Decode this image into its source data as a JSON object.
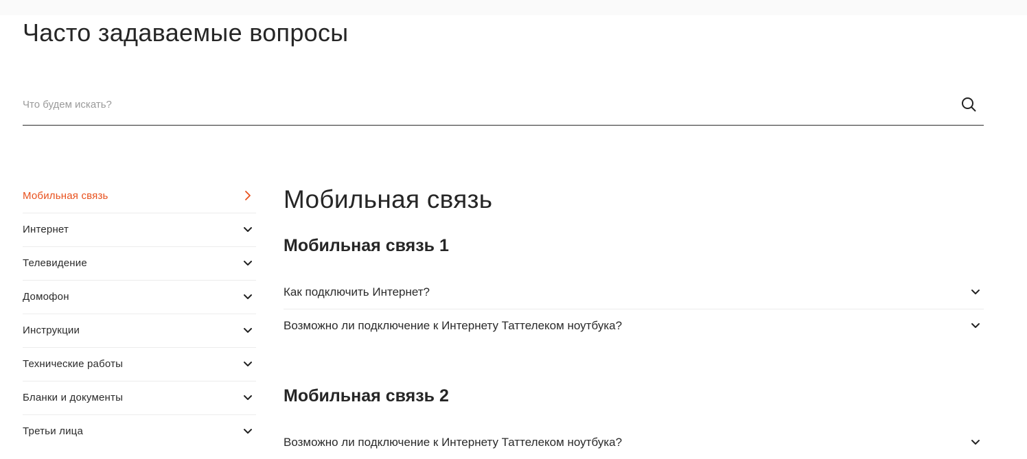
{
  "page": {
    "title": "Часто задаваемые вопросы"
  },
  "search": {
    "placeholder": "Что будем искать?",
    "value": ""
  },
  "sidebar": {
    "items": [
      {
        "label": "Мобильная связь",
        "active": true,
        "icon": "chevron-right-icon"
      },
      {
        "label": "Интернет",
        "icon": "chevron-down-icon"
      },
      {
        "label": "Телевидение",
        "icon": "chevron-down-icon"
      },
      {
        "label": "Домофон",
        "icon": "chevron-down-icon"
      },
      {
        "label": "Инструкции",
        "icon": "chevron-down-icon"
      },
      {
        "label": "Технические работы",
        "icon": "chevron-down-icon"
      },
      {
        "label": "Бланки и документы",
        "icon": "chevron-down-icon"
      },
      {
        "label": "Третьи лица",
        "icon": "chevron-down-icon"
      }
    ]
  },
  "main": {
    "title": "Мобильная связь",
    "sections": [
      {
        "title": "Мобильная связь 1",
        "questions": [
          "Как подключить Интернет?",
          "Возможно ли подключение к Интернету Таттелеком ноутбука?"
        ]
      },
      {
        "title": "Мобильная связь 2",
        "questions": [
          "Возможно ли подключение к Интернету Таттелеком ноутбука?"
        ]
      }
    ]
  },
  "colors": {
    "accent": "#e8501c",
    "text": "#262626",
    "divider": "#ececec"
  }
}
